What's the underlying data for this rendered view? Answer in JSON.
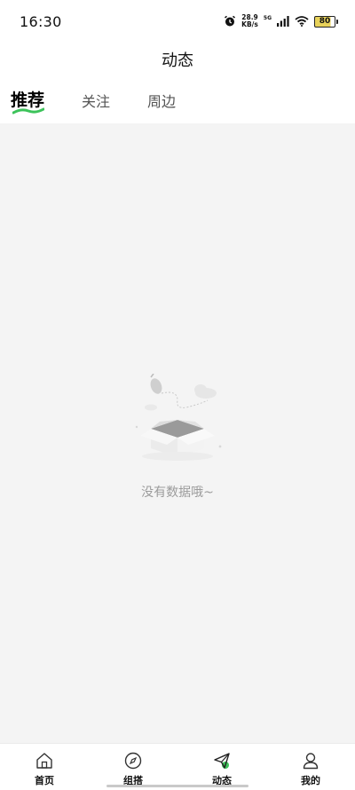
{
  "status_bar": {
    "time": "16:30",
    "net_speed_value": "28.9",
    "net_speed_unit": "KB/s",
    "net_type": "5G",
    "battery": "80",
    "icons": [
      "alarm-icon",
      "signal-icon",
      "wifi-icon",
      "battery-icon"
    ]
  },
  "header": {
    "title": "动态"
  },
  "tabs": [
    {
      "label": "推荐",
      "active": true
    },
    {
      "label": "关注",
      "active": false
    },
    {
      "label": "周边",
      "active": false
    }
  ],
  "empty_state": {
    "text": "没有数据哦~"
  },
  "tabbar": [
    {
      "label": "首页",
      "icon": "home-icon"
    },
    {
      "label": "组搭",
      "icon": "compass-icon"
    },
    {
      "label": "动态",
      "icon": "paper-plane-icon",
      "active": true
    },
    {
      "label": "我的",
      "icon": "profile-icon"
    }
  ],
  "colors": {
    "accent": "#3cc35a",
    "background": "#f4f4f4",
    "empty_text": "#9b9b9b"
  }
}
